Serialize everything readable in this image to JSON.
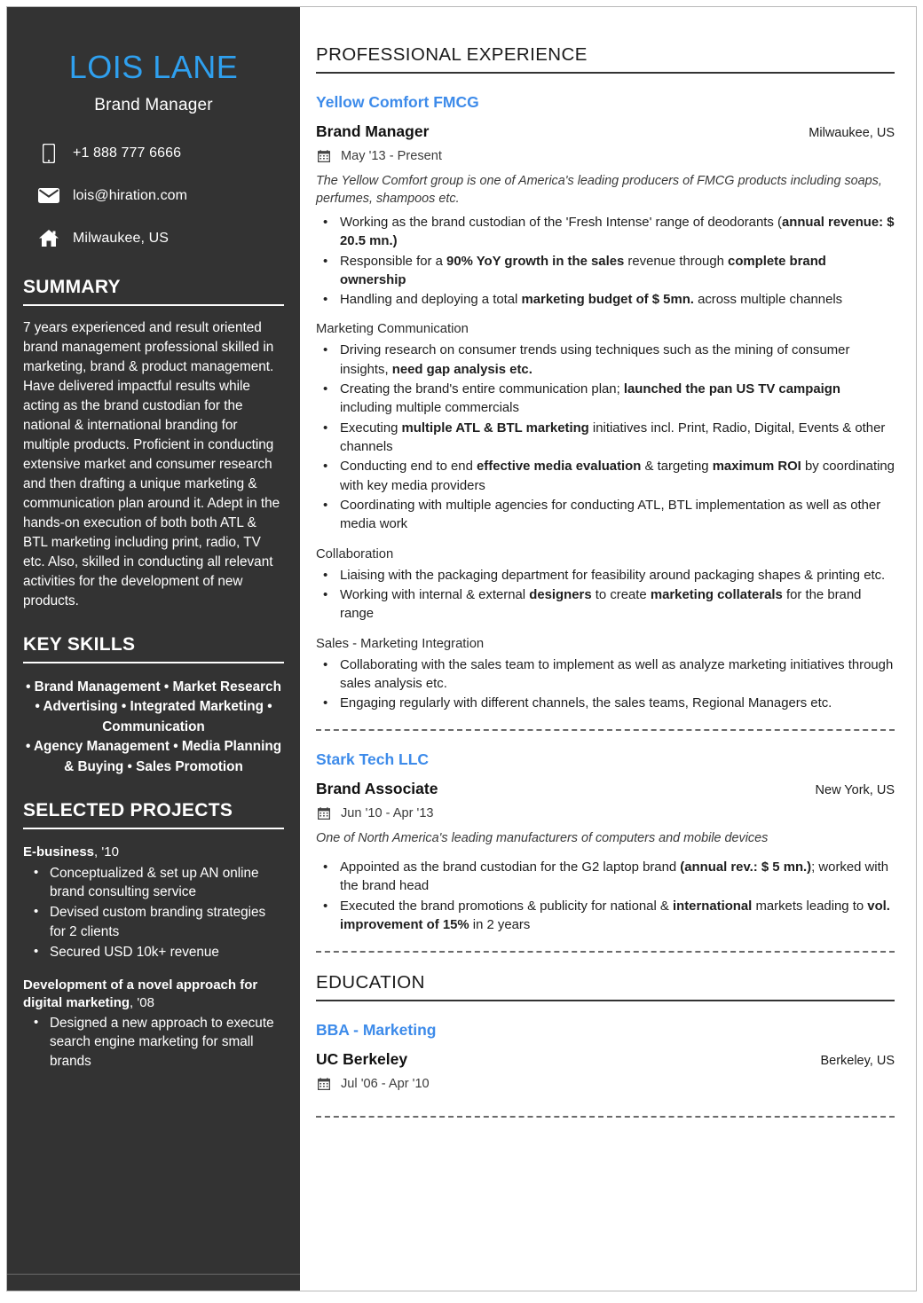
{
  "sidebar": {
    "name": "LOIS LANE",
    "role": "Brand Manager",
    "accent_color": "#2fa0ef",
    "background_color": "#333333",
    "contacts": [
      {
        "icon": "mobile-phone-icon",
        "value": "+1 888 777 6666"
      },
      {
        "icon": "envelope-icon",
        "value": "lois@hiration.com"
      },
      {
        "icon": "home-icon",
        "value": "Milwaukee, US"
      }
    ],
    "summary": {
      "heading": "SUMMARY",
      "text": "7 years experienced and result oriented brand management professional skilled in marketing, brand & product management. Have delivered impactful results while acting as the brand custodian for the national & international branding for multiple products. Proficient in conducting extensive market and consumer research and then drafting a unique marketing & communication plan around it. Adept in the hands-on execution of both both ATL & BTL marketing including print, radio, TV etc. Also, skilled in conducting all relevant activities for the development of new products."
    },
    "key_skills": {
      "heading": "KEY SKILLS",
      "line1": "• Brand Management • Market Research",
      "line2": "• Advertising • Integrated Marketing • Communication",
      "line3": "• Agency Management • Media Planning & Buying • Sales Promotion"
    },
    "projects": {
      "heading": "SELECTED PROJECTS",
      "items": [
        {
          "name": "E-business",
          "year": ", '10",
          "bullets": [
            "Conceptualized & set up AN online brand consulting service",
            "Devised custom branding strategies for 2 clients",
            "Secured USD 10k+ revenue"
          ]
        },
        {
          "name": "Development of a novel approach for digital marketing",
          "year": ", '08",
          "bullets": [
            "Designed a new approach to execute search engine marketing for small brands"
          ]
        }
      ]
    }
  },
  "main": {
    "accent_color": "#3d8bea",
    "experience": {
      "heading": "PROFESSIONAL EXPERIENCE",
      "jobs": [
        {
          "company": "Yellow Comfort FMCG",
          "title": "Brand Manager",
          "location": "Milwaukee, US",
          "date_icon": "calendar-icon",
          "dates": "May '13 -  Present",
          "blurb": "The Yellow Comfort group is one of America's leading producers of FMCG products including soaps, perfumes, shampoos etc.",
          "groups": [
            {
              "subhead": "",
              "bullets": [
                "Working as the brand custodian of the 'Fresh Intense' range of deodorants (annual revenue: $ 20.5 mn.)",
                "Responsible for a 90% YoY growth in the sales revenue through complete brand ownership",
                "Handling and deploying a total marketing budget of $ 5mn. across multiple channels"
              ]
            },
            {
              "subhead": "Marketing Communication",
              "bullets": [
                "Driving research on consumer trends using techniques such as the mining of consumer insights, need gap analysis etc.",
                "Creating the brand's entire communication plan; launched the pan US TV campaign including multiple commercials",
                "Executing multiple ATL & BTL marketing initiatives incl. Print, Radio, Digital, Events & other channels",
                "Conducting end to end effective media evaluation & targeting maximum ROI by coordinating with key media providers",
                "Coordinating with multiple agencies for conducting ATL, BTL implementation as well as other media work"
              ]
            },
            {
              "subhead": "Collaboration",
              "bullets": [
                "Liaising with the packaging department for feasibility around packaging shapes & printing etc.",
                "Working with internal & external designers to create marketing collaterals for the brand range"
              ]
            },
            {
              "subhead": "Sales - Marketing Integration",
              "bullets": [
                "Collaborating with the sales team to implement as well as analyze marketing initiatives through sales analysis etc.",
                "Engaging regularly with different channels, the sales teams, Regional Managers etc."
              ]
            }
          ]
        },
        {
          "company": "Stark Tech LLC",
          "title": "Brand Associate",
          "location": "New York, US",
          "date_icon": "calendar-icon",
          "dates": "Jun '10 -  Apr '13",
          "blurb": "One of North America's leading manufacturers of computers and mobile devices",
          "groups": [
            {
              "subhead": "",
              "bullets": [
                "Appointed as the brand custodian for the G2 laptop brand (annual rev.: $ 5 mn.); worked with the brand head",
                "Executed the brand promotions & publicity for national & international markets leading to vol. improvement of 15% in 2 years"
              ]
            }
          ]
        }
      ]
    },
    "education": {
      "heading": "EDUCATION",
      "items": [
        {
          "degree": "BBA - Marketing",
          "school": "UC Berkeley",
          "location": "Berkeley, US",
          "date_icon": "calendar-icon",
          "dates": "Jul '06 -  Apr '10"
        }
      ]
    }
  }
}
